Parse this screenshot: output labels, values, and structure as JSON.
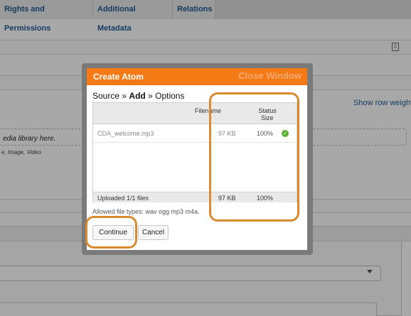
{
  "background": {
    "tabs": [
      "Rights and Permissions",
      "Additional Metadata",
      "Relations"
    ],
    "show_row_weights": "Show row weights",
    "dropzone_text": "edia library here.",
    "dropzone_types": "e, Image, Video",
    "icon": "export-icon"
  },
  "modal": {
    "title": "Create Atom",
    "close_label": "Close Window",
    "breadcrumb": {
      "step1": "Source",
      "separator": "»",
      "current": "Add",
      "step3": "Options"
    },
    "table": {
      "headers": {
        "filename": "Filename",
        "status": "Status",
        "size": "Size"
      },
      "files": [
        {
          "name": "CDA_welcome.mp3",
          "size": "97 KB",
          "progress": "100%",
          "status_icon": "check-circle-icon"
        }
      ],
      "footer": {
        "label": "Uploaded 1/1 files",
        "size": "97 KB",
        "progress": "100%"
      }
    },
    "allowed_types": "Allowed file types: wav ogg mp3 m4a.",
    "buttons": {
      "continue": "Continue",
      "cancel": "Cancel"
    }
  },
  "colors": {
    "header_orange": "#f47a16",
    "annotation_orange": "#d98a2f",
    "link_blue": "#1f5c93",
    "success_green": "#5cb035"
  }
}
